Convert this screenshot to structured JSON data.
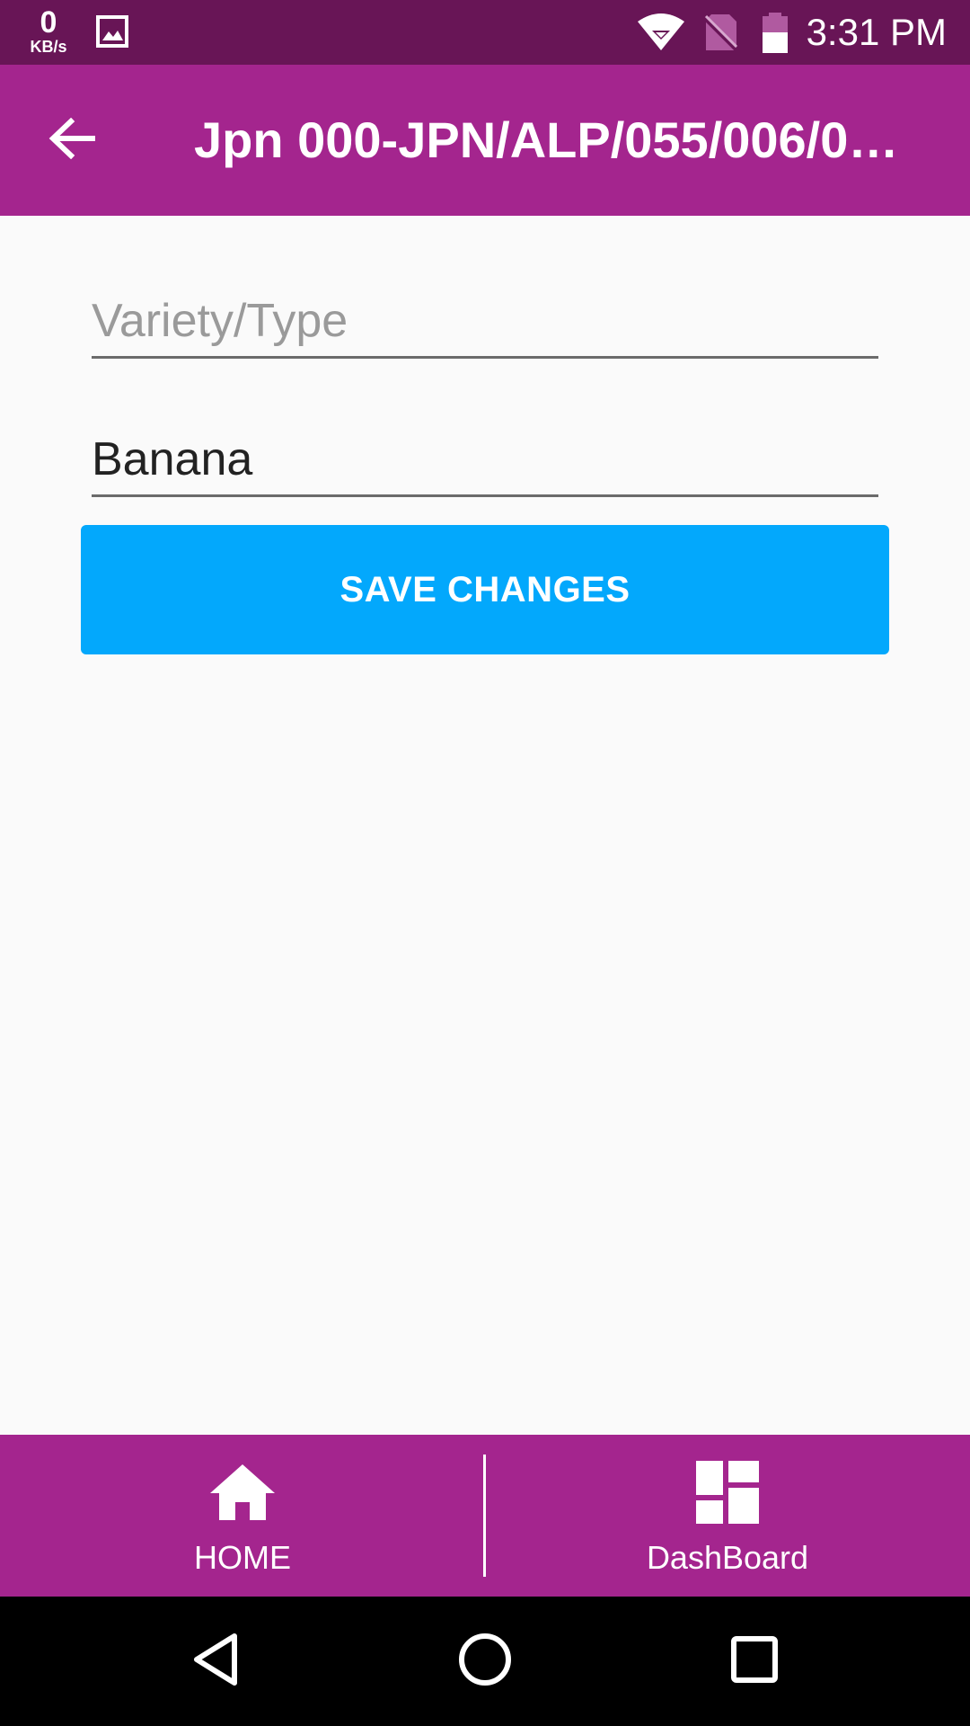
{
  "status_bar": {
    "speed_value": "0",
    "speed_unit": "KB/s",
    "time": "3:31 PM",
    "icons": [
      "image-icon",
      "wifi-icon",
      "no-sim-icon",
      "battery-icon"
    ]
  },
  "app_bar": {
    "title": "Jpn 000-JPN/ALP/055/006/0…",
    "back_icon": "arrow-left-icon"
  },
  "form": {
    "variety_placeholder": "Variety/Type",
    "variety_value": "",
    "name_value": "Banana",
    "save_label": "SAVE CHANGES"
  },
  "bottom_nav": {
    "home_label": "HOME",
    "dashboard_label": "DashBoard"
  },
  "colors": {
    "status_bar": "#681556",
    "app_bar": "#a4258e",
    "accent_button": "#03a8fc",
    "background": "#fafafa"
  }
}
